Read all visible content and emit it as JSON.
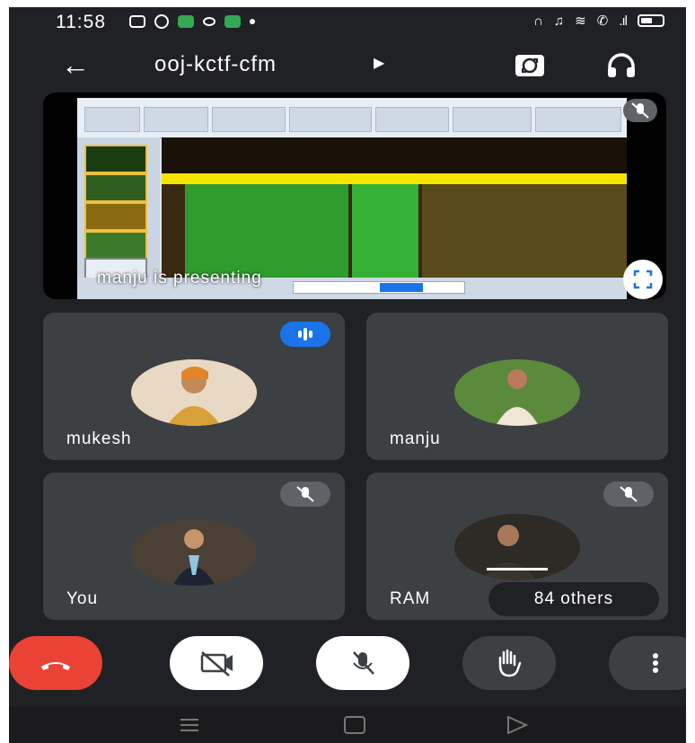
{
  "status_bar": {
    "time": "11:58"
  },
  "meeting": {
    "code": "ooj-kctf-cfm"
  },
  "presentation": {
    "caption": "manju is presenting"
  },
  "participants": [
    {
      "name": "mukesh",
      "speaking": true,
      "muted": false
    },
    {
      "name": "manju",
      "speaking": false,
      "muted": false
    },
    {
      "name": "You",
      "speaking": false,
      "muted": true
    },
    {
      "name": "RAM",
      "speaking": false,
      "muted": true
    }
  ],
  "others_pill": "84 others",
  "controls": [
    "end-call",
    "camera-off",
    "microphone-off",
    "raise-hand",
    "more-options"
  ],
  "colors": {
    "background": "#202124",
    "tile": "#3c4043",
    "end_call": "#ea4335",
    "speaking": "#1a73e8"
  }
}
